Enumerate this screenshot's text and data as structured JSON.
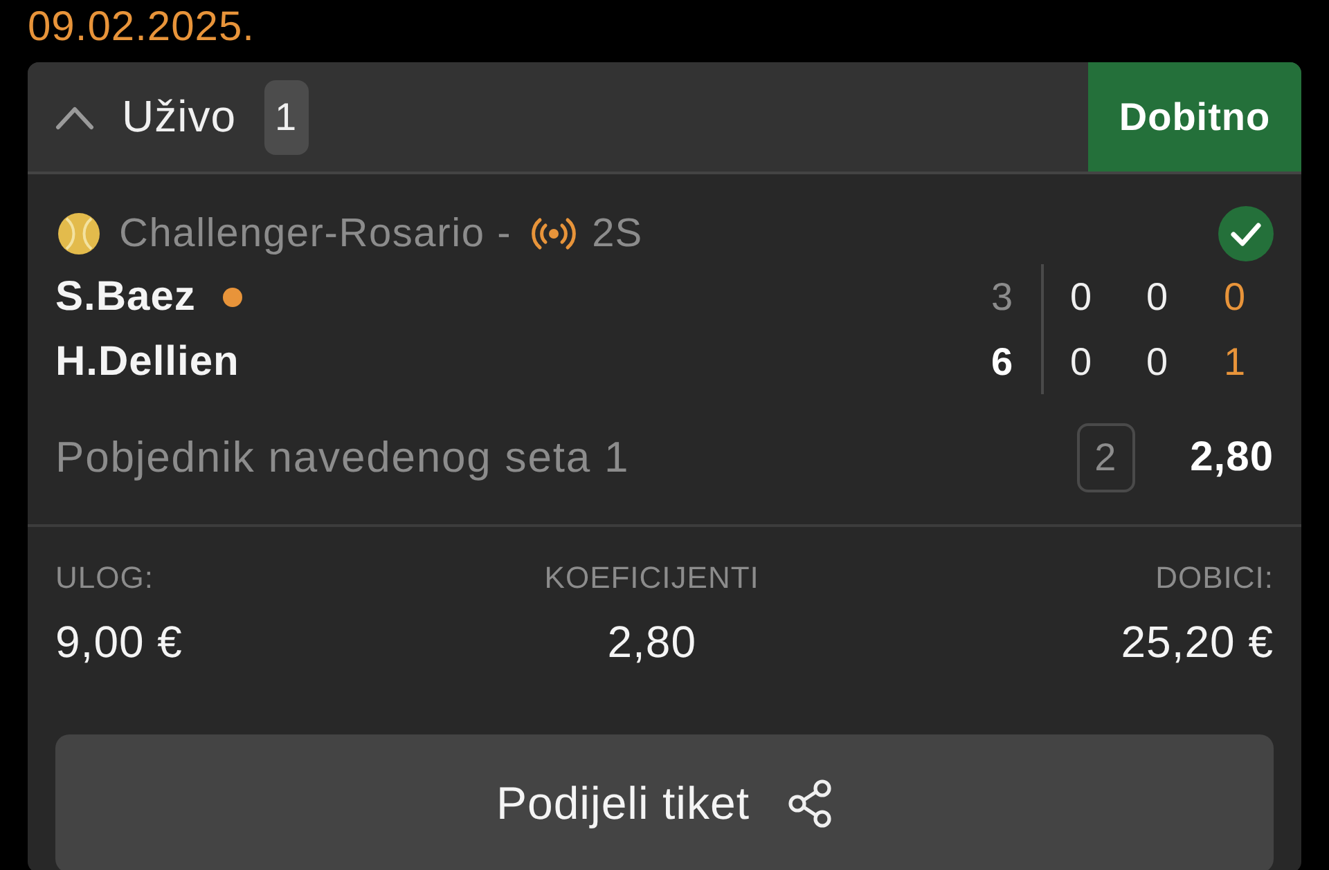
{
  "date": "09.02.2025.",
  "header": {
    "expanded": true,
    "label": "Uživo",
    "count": "1",
    "status": {
      "label": "Dobitno",
      "kind": "won"
    }
  },
  "event": {
    "league": "Challenger-Rosario -",
    "live": true,
    "period": "2S",
    "won": true,
    "competitors": [
      {
        "name": "S.Baez",
        "serving": true,
        "scores": [
          {
            "kind": "completed",
            "value": "3",
            "won": false
          },
          {
            "kind": "plain",
            "value": "0"
          },
          {
            "kind": "plain",
            "value": "0"
          },
          {
            "kind": "current",
            "value": "0"
          }
        ]
      },
      {
        "name": "H.Dellien",
        "serving": false,
        "scores": [
          {
            "kind": "completed",
            "value": "6",
            "won": true
          },
          {
            "kind": "plain",
            "value": "0"
          },
          {
            "kind": "plain",
            "value": "0"
          },
          {
            "kind": "current",
            "value": "1"
          }
        ]
      }
    ],
    "market": "Pobjednik navedenog seta 1",
    "pick": "2",
    "odds": "2,80"
  },
  "summary": [
    {
      "label": "ULOG:",
      "value": "9,00 €"
    },
    {
      "label": "KOEFICIJENTI",
      "value": "2,80"
    },
    {
      "label": "DOBICI:",
      "value": "25,20 €"
    }
  ],
  "button": {
    "label": "Podijeli tiket"
  }
}
